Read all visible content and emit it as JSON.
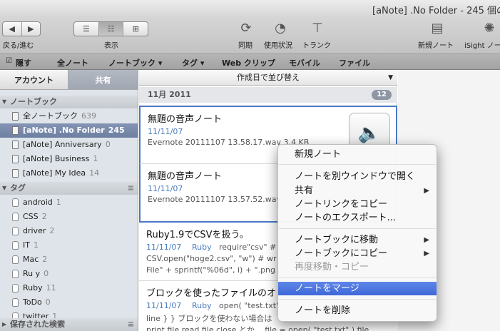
{
  "window": {
    "title": "[aNote] .No Folder - 245 個の"
  },
  "toolbar": {
    "back_forward_label": "戻る/進む",
    "view_label": "表示",
    "sync_label": "同期",
    "usage_label": "使用状況",
    "trunk_label": "トランク",
    "new_note_label": "新規ノート",
    "isight_label": "iSight ノー"
  },
  "tagbar": {
    "items": [
      "隠す",
      "全ノート",
      "ノートブック ▾",
      "タグ ▾",
      "Web クリップ",
      "モバイル",
      "ファイル"
    ]
  },
  "sidebar": {
    "tabs": [
      "アカウント",
      "共有"
    ],
    "notebook_header": "ノートブック",
    "notebooks": [
      {
        "label": "全ノートブック",
        "count": "639"
      },
      {
        "label": "[aNote] .No Folder",
        "count": "245"
      },
      {
        "label": "[aNote] Anniversary",
        "count": "0"
      },
      {
        "label": "[aNote] Business",
        "count": "1"
      },
      {
        "label": "[aNote] My Idea",
        "count": "14"
      }
    ],
    "tag_header": "タグ",
    "tags": [
      {
        "label": "android",
        "count": "1"
      },
      {
        "label": "CSS",
        "count": "2"
      },
      {
        "label": "driver",
        "count": "2"
      },
      {
        "label": "IT",
        "count": "1"
      },
      {
        "label": "Mac",
        "count": "2"
      },
      {
        "label": "Ru y",
        "count": "0"
      },
      {
        "label": "Ruby",
        "count": "11"
      },
      {
        "label": "ToDo",
        "count": "0"
      },
      {
        "label": "twitter",
        "count": "1"
      }
    ],
    "saved_search_header": "保存された検索"
  },
  "notelist": {
    "sort_label": "作成日で並び替え",
    "month": "11月 2011",
    "month_count": "12",
    "notes": [
      {
        "title": "無題の音声ノート",
        "date": "11/11/07",
        "tag": "",
        "text": "Evernote 20111107 13.58.17.wav 3.4 KB",
        "text2": ""
      },
      {
        "title": "無題の音声ノート",
        "date": "11/11/07",
        "tag": "",
        "text": "Evernote 20111107 13.57.52.wav",
        "text2": ""
      },
      {
        "title": "Ruby1.9でCSVを扱う。",
        "date": "11/11/07",
        "tag": "Ruby",
        "text": "require\"csv\" #",
        "text2": "CSV.open(\"hoge2.csv\", \"w\") # wr",
        "text3": "File\" + sprintf(\"%06d\", i) + \".png"
      },
      {
        "title": "ブロックを使ったファイルのオ",
        "date": "11/11/07",
        "tag": "Ruby",
        "text": "open( \"test.txt\"",
        "text2": "line } } ブロックを使わない場合は",
        "text3": "print file.read file.close とか、 file = open( \"test.txt\" ) file."
      }
    ]
  },
  "context_menu": {
    "items": [
      {
        "label": "新規ノート",
        "type": "item"
      },
      {
        "label": "ノートを別ウインドウで開く",
        "type": "item"
      },
      {
        "label": "共有",
        "type": "submenu"
      },
      {
        "label": "ノートリンクをコピー",
        "type": "item"
      },
      {
        "label": "ノートのエクスポート...",
        "type": "item"
      },
      {
        "label": "ノートブックに移動",
        "type": "submenu"
      },
      {
        "label": "ノートブックにコピー",
        "type": "submenu"
      },
      {
        "label": "再度移動・コピー",
        "type": "disabled"
      },
      {
        "label": "ノートをマージ",
        "type": "highlighted"
      },
      {
        "label": "ノートを削除",
        "type": "item"
      }
    ]
  }
}
